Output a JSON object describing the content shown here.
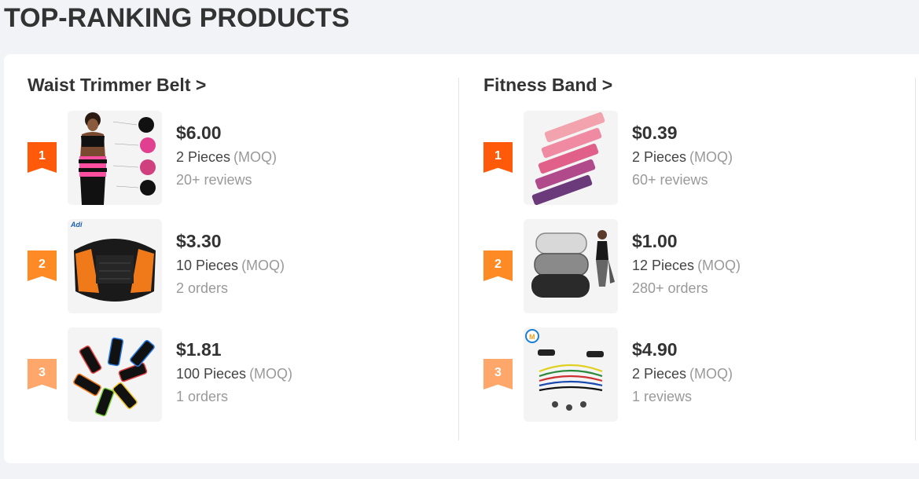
{
  "page": {
    "title": "TOP-RANKING PRODUCTS"
  },
  "colors": {
    "rank1": "#ff5a0a",
    "rank2": "#fd8a25",
    "rank3": "#ffa66a",
    "accent_text": "#333333",
    "muted_text": "#999999"
  },
  "categories": [
    {
      "title": "Waist Trimmer Belt >",
      "products": [
        {
          "rank": "1",
          "price": "$6.00",
          "quantity": "2 Pieces",
          "moq_label": "(MOQ)",
          "meta": "20+ reviews",
          "image_icon": "waist-trainer-model-image"
        },
        {
          "rank": "2",
          "price": "$3.30",
          "quantity": "10 Pieces",
          "moq_label": "(MOQ)",
          "meta": "2 orders",
          "image_icon": "back-support-belt-image",
          "image_logo": "Adi"
        },
        {
          "rank": "3",
          "price": "$1.81",
          "quantity": "100 Pieces",
          "moq_label": "(MOQ)",
          "meta": "1 orders",
          "image_icon": "sleeve-bands-image"
        }
      ]
    },
    {
      "title": "Fitness Band >",
      "products": [
        {
          "rank": "1",
          "price": "$0.39",
          "quantity": "2 Pieces",
          "moq_label": "(MOQ)",
          "meta": "60+ reviews",
          "image_icon": "resistance-loops-image"
        },
        {
          "rank": "2",
          "price": "$1.00",
          "quantity": "12 Pieces",
          "moq_label": "(MOQ)",
          "meta": "280+ orders",
          "image_icon": "fabric-hip-bands-image"
        },
        {
          "rank": "3",
          "price": "$4.90",
          "quantity": "2 Pieces",
          "moq_label": "(MOQ)",
          "meta": "1 reviews",
          "image_icon": "tube-resistance-set-image"
        }
      ]
    }
  ]
}
